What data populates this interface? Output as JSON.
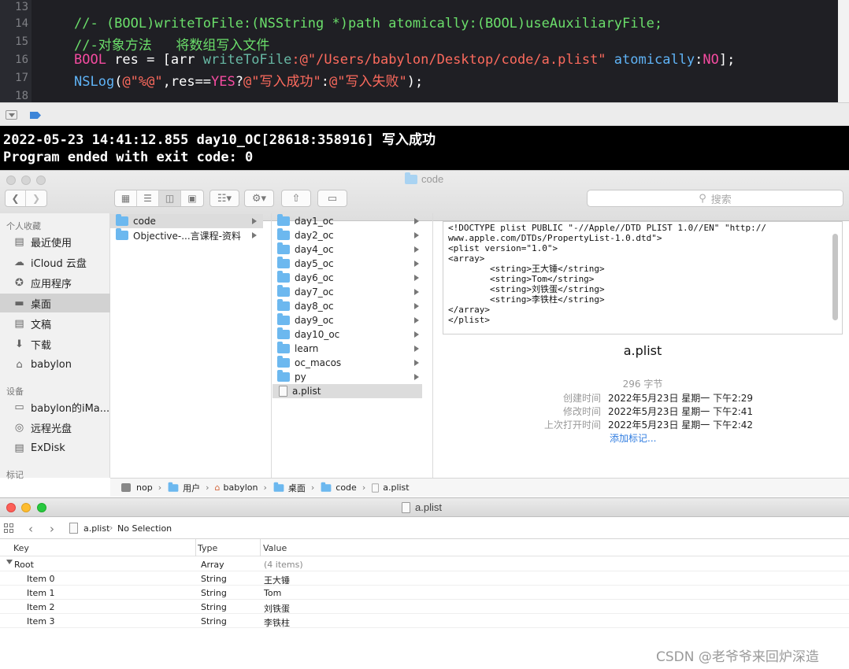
{
  "editor": {
    "lines": [
      {
        "num": "13"
      },
      {
        "num": "14",
        "text": "//- (BOOL)writeToFile:(NSString *)path atomically:(BOOL)useAuxiliaryFile;"
      },
      {
        "num": "15",
        "text": "//-对象方法   将数组写入文件"
      },
      {
        "num": "16",
        "parts": [
          "BOOL",
          " res = [arr ",
          "writeToFile",
          ":@\"/Users/babylon/Desktop/code/a.plist\"",
          " ",
          "atomically",
          ":",
          "NO",
          "];"
        ]
      },
      {
        "num": "17",
        "parts": [
          "NSLog",
          "(",
          "@\"%@\"",
          ",res==",
          "YES",
          "?",
          "@\"写入成功\"",
          ":",
          "@\"写入失败\"",
          ");"
        ]
      },
      {
        "num": "18"
      }
    ]
  },
  "console": {
    "line1": "2022-05-23 14:41:12.855 day10_OC[28618:358916] 写入成功",
    "line2": "Program ended with exit code: 0"
  },
  "finder": {
    "title": "code",
    "search_placeholder": "搜索",
    "sidebar": {
      "favorites_header": "个人收藏",
      "favorites": [
        {
          "label": "最近使用",
          "icon": "recents-icon"
        },
        {
          "label": "iCloud 云盘",
          "icon": "icloud-icon"
        },
        {
          "label": "应用程序",
          "icon": "applications-icon"
        },
        {
          "label": "桌面",
          "icon": "desktop-icon",
          "selected": true
        },
        {
          "label": "文稿",
          "icon": "documents-icon"
        },
        {
          "label": "下载",
          "icon": "downloads-icon"
        },
        {
          "label": "babylon",
          "icon": "home-icon"
        }
      ],
      "devices_header": "设备",
      "devices": [
        {
          "label": "babylon的iMa...",
          "icon": "computer-icon"
        },
        {
          "label": "远程光盘",
          "icon": "disc-icon"
        },
        {
          "label": "ExDisk",
          "icon": "disk-icon"
        }
      ],
      "tags_header": "标记"
    },
    "col1": [
      {
        "label": "code",
        "selected": true
      },
      {
        "label": "Objective-...言课程-资料"
      }
    ],
    "col2": [
      "day1_oc",
      "day2_oc",
      "day4_oc",
      "day5_oc",
      "day6_oc",
      "day7_oc",
      "day8_oc",
      "day9_oc",
      "day10_oc",
      "learn",
      "oc_macos",
      "py"
    ],
    "col2_file": "a.plist",
    "preview": {
      "text": "<!DOCTYPE plist PUBLIC \"-//Apple//DTD PLIST 1.0//EN\" \"http://\nwww.apple.com/DTDs/PropertyList-1.0.dtd\">\n<plist version=\"1.0\">\n<array>\n        <string>王大锤</string>\n        <string>Tom</string>\n        <string>刘铁蛋</string>\n        <string>李铁柱</string>\n</array>\n</plist>",
      "name": "a.plist",
      "size": "296 字节",
      "created_label": "创建时间",
      "created": "2022年5月23日 星期一 下午2:29",
      "modified_label": "修改时间",
      "modified": "2022年5月23日 星期一 下午2:41",
      "opened_label": "上次打开时间",
      "opened": "2022年5月23日 星期一 下午2:42",
      "add_tags": "添加标记..."
    },
    "path": [
      "nop",
      "用户",
      "babylon",
      "桌面",
      "code",
      "a.plist"
    ]
  },
  "plist": {
    "title": "a.plist",
    "breadcrumb_file": "a.plist",
    "breadcrumb_sel": "No Selection",
    "headers": {
      "key": "Key",
      "type": "Type",
      "value": "Value"
    },
    "root": {
      "key": "Root",
      "type": "Array",
      "value": "(4 items)"
    },
    "items": [
      {
        "key": "Item 0",
        "type": "String",
        "value": "王大锤"
      },
      {
        "key": "Item 1",
        "type": "String",
        "value": "Tom"
      },
      {
        "key": "Item 2",
        "type": "String",
        "value": "刘铁蛋"
      },
      {
        "key": "Item 3",
        "type": "String",
        "value": "李铁柱"
      }
    ]
  },
  "watermark": "CSDN @老爷爷来回炉深造"
}
